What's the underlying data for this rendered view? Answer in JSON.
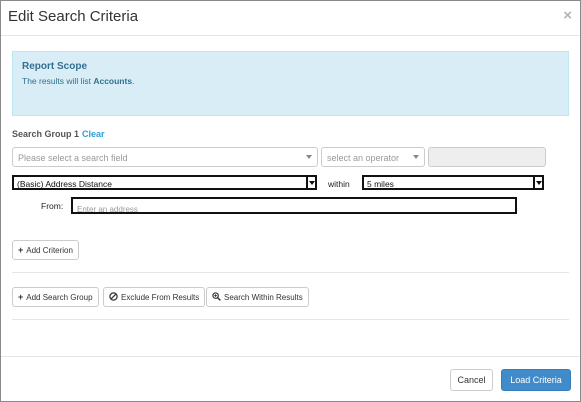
{
  "modal": {
    "title": "Edit Search Criteria",
    "close_glyph": "×"
  },
  "scope": {
    "title": "Report Scope",
    "text_prefix": "The results will list ",
    "entity": "Accounts",
    "text_suffix": "."
  },
  "group": {
    "label": "Search Group 1",
    "clear_label": "Clear"
  },
  "criterion_row": {
    "field_placeholder": "Please select a search field",
    "operator_placeholder": "select an operator"
  },
  "distance_row": {
    "field_value": "(Basic) Address Distance",
    "within_label": "within",
    "distance_value": "5 miles",
    "from_label": "From:",
    "address_placeholder": "Enter an address"
  },
  "buttons": {
    "add_criterion": "Add Criterion",
    "add_search_group": "Add Search Group",
    "exclude_from_results": "Exclude From Results",
    "search_within_results": "Search Within Results",
    "cancel": "Cancel",
    "load_criteria": "Load Criteria"
  },
  "icons": {
    "add_criterion": "plus-icon",
    "add_search_group": "plus-icon",
    "exclude_from_results": "ban-icon",
    "search_within_results": "zoom-in-icon"
  },
  "colors": {
    "primary": "#428bca",
    "info_bg": "#d9edf7",
    "info_text": "#31708f",
    "link": "#2a9fd6"
  }
}
